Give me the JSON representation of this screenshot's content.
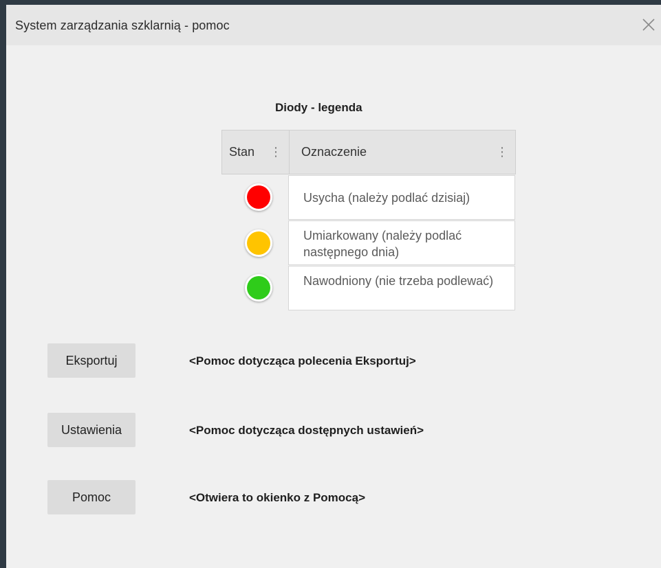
{
  "window": {
    "title": "System zarządzania szklarnią - pomoc",
    "close_icon": "close-icon"
  },
  "legend": {
    "title": "Diody - legenda",
    "columns": [
      "Stan",
      "Oznaczenie"
    ],
    "rows": [
      {
        "color": "#ff0000",
        "label": "Usycha (należy podlać dzisiaj)"
      },
      {
        "color": "#ffc400",
        "label": "Umiarkowany (należy podlać następnego dnia)"
      },
      {
        "color": "#2fcc1a",
        "label": "Nawodniony (nie trzeba podlewać)"
      }
    ]
  },
  "actions": [
    {
      "label": "Eksportuj",
      "help": "<Pomoc dotycząca polecenia Eksportuj>"
    },
    {
      "label": "Ustawienia",
      "help": "<Pomoc dotycząca dostępnych ustawień>"
    },
    {
      "label": "Pomoc",
      "help": "<Otwiera to okienko z Pomocą>"
    }
  ],
  "colors": {
    "background": "#2f3a44",
    "dialog": "#f0f0f0",
    "titlebar": "#e6e6e6",
    "button": "#dcdcdc"
  }
}
